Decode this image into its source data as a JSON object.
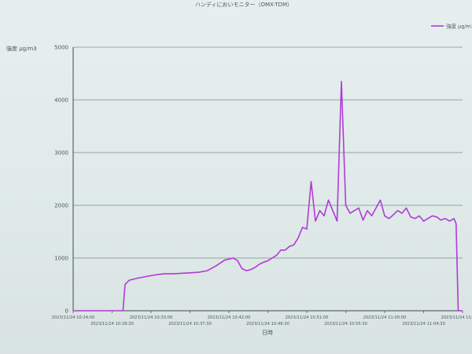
{
  "chart_data": {
    "type": "line",
    "title": "ハンディにおいモニター（OMX-TDM）",
    "ylabel": "強度 μg/m3",
    "xlabel": "日時",
    "ylim": [
      0,
      5000
    ],
    "yticks": [
      "0",
      "1000",
      "2000",
      "3000",
      "4000",
      "5000"
    ],
    "xlim": [
      "2023/11/24 10:24:00",
      "2023/11/24 11:09:00"
    ],
    "x_tick_labels_upper": [
      "2023/11/24 10:24:00",
      "2023/11/24 10:33:00",
      "2023/11/24 10:42:00",
      "2023/11/24 10:51:00",
      "2023/11/24 11:00:00",
      "2023/11/24 11:09:00"
    ],
    "x_tick_labels_lower": [
      "2023/11/24 10:28:30",
      "2023/11/24 10:37:30",
      "2023/11/24 10:46:30",
      "2023/11/24 10:55:30",
      "2023/11/24 11:04:30"
    ],
    "grid": true,
    "legend_position": "top-right",
    "series": [
      {
        "name": "強度 μg/m3",
        "color": "#b23ad6",
        "x": [
          "10:24:00",
          "10:29:45",
          "10:30:00",
          "10:30:30",
          "10:31:30",
          "10:32:30",
          "10:33:30",
          "10:34:30",
          "10:35:30",
          "10:36:30",
          "10:37:30",
          "10:38:30",
          "10:39:30",
          "10:40:30",
          "10:41:30",
          "10:42:30",
          "10:43:00",
          "10:43:30",
          "10:44:00",
          "10:44:30",
          "10:45:00",
          "10:45:30",
          "10:46:00",
          "10:46:30",
          "10:47:00",
          "10:47:30",
          "10:48:00",
          "10:48:30",
          "10:49:00",
          "10:49:30",
          "10:50:00",
          "10:50:30",
          "10:51:00",
          "10:51:30",
          "10:52:00",
          "10:52:30",
          "10:53:00",
          "10:53:30",
          "10:54:00",
          "10:54:30",
          "10:55:00",
          "10:55:30",
          "10:56:00",
          "10:56:30",
          "10:57:00",
          "10:57:30",
          "10:58:00",
          "10:58:30",
          "10:59:00",
          "10:59:30",
          "11:00:00",
          "11:00:30",
          "11:01:00",
          "11:01:30",
          "11:02:00",
          "11:02:30",
          "11:03:00",
          "11:03:30",
          "11:04:00",
          "11:04:30",
          "11:05:00",
          "11:05:30",
          "11:06:00",
          "11:06:30",
          "11:07:00",
          "11:07:30",
          "11:08:00",
          "11:08:15",
          "11:08:30",
          "11:09:00"
        ],
        "values": [
          0,
          0,
          500,
          580,
          620,
          650,
          680,
          700,
          700,
          710,
          720,
          730,
          760,
          850,
          960,
          1000,
          950,
          800,
          760,
          780,
          820,
          880,
          920,
          950,
          1000,
          1050,
          1150,
          1150,
          1220,
          1250,
          1380,
          1580,
          1550,
          2450,
          1700,
          1900,
          1800,
          2100,
          1900,
          1700,
          4350,
          2000,
          1850,
          1900,
          1950,
          1720,
          1900,
          1800,
          1950,
          2100,
          1800,
          1750,
          1820,
          1900,
          1850,
          1950,
          1780,
          1750,
          1800,
          1700,
          1750,
          1800,
          1780,
          1720,
          1750,
          1700,
          1750,
          1650,
          0,
          0
        ]
      }
    ]
  }
}
